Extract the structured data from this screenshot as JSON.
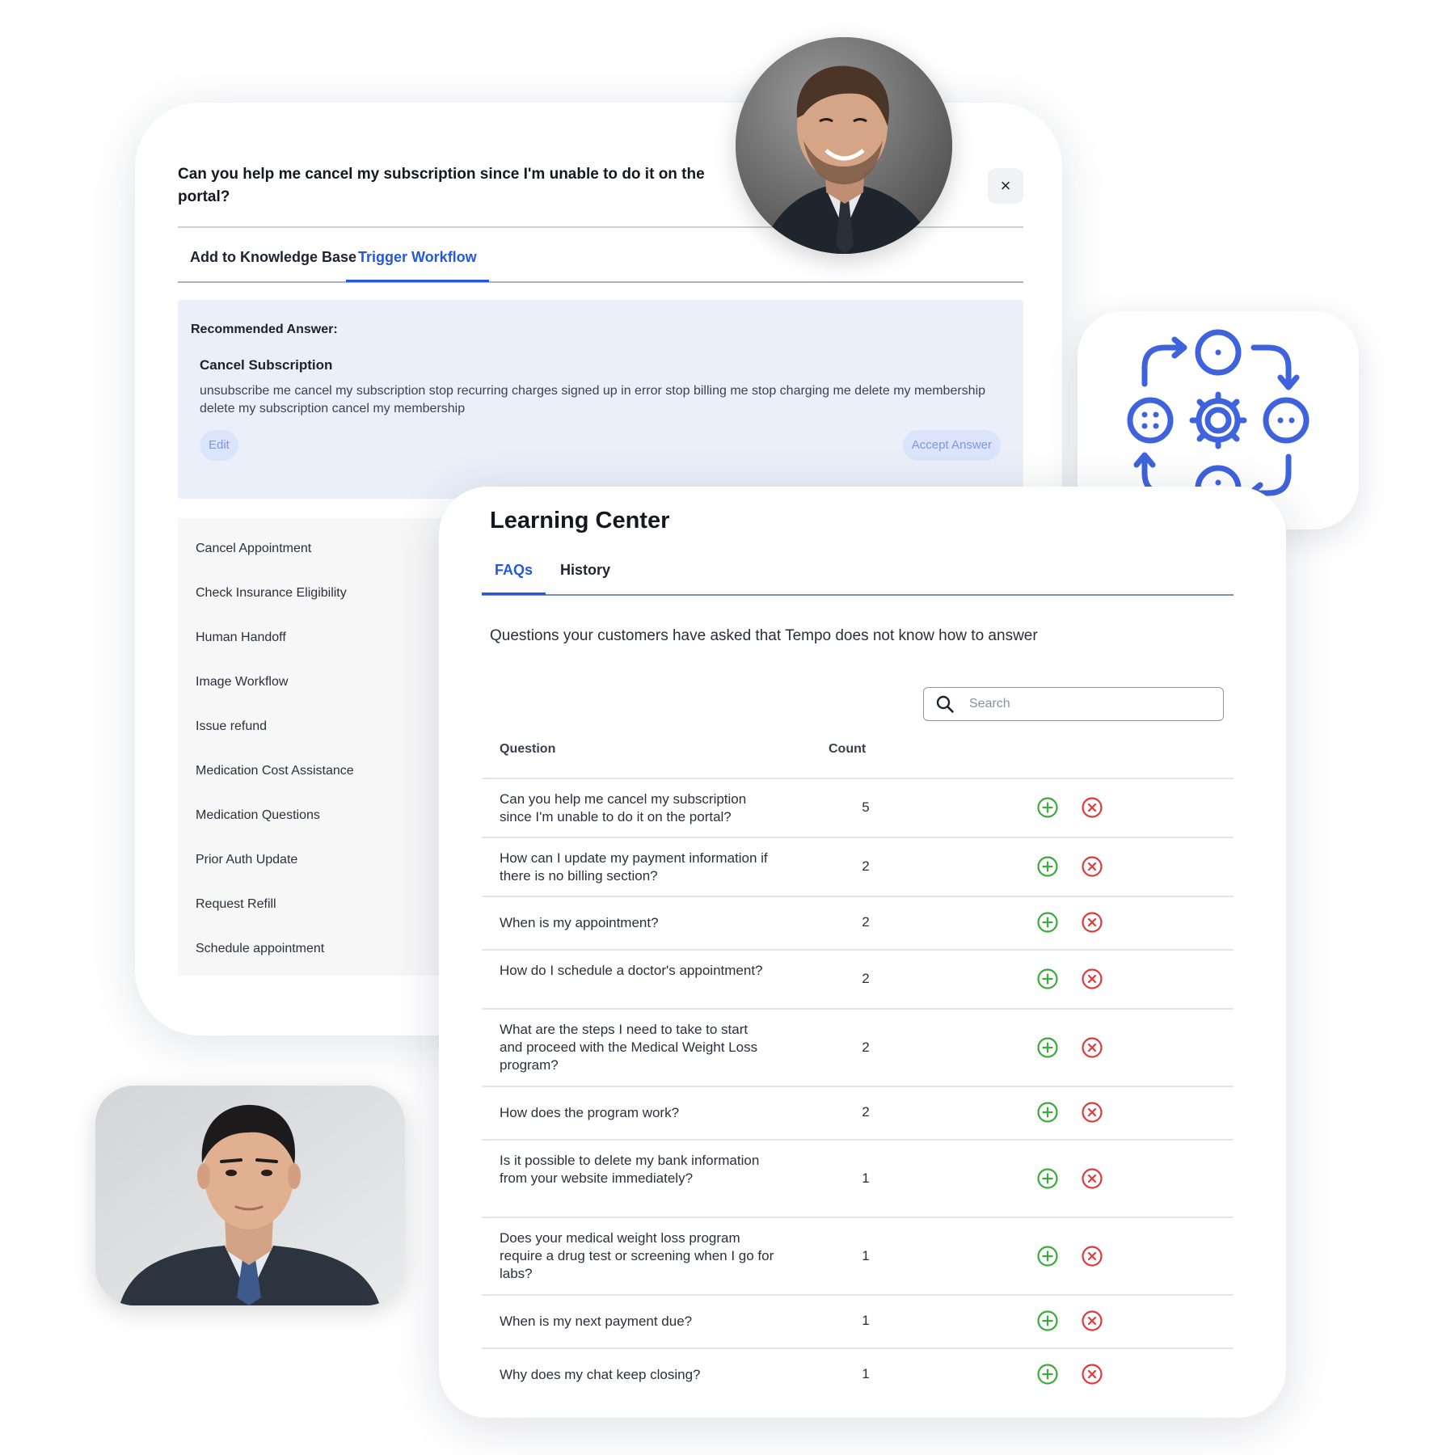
{
  "kb_dialog": {
    "question": "Can you help me cancel my subscription since I'm unable to do it on the portal?",
    "close_label": "×",
    "tabs": [
      {
        "label": "Add to Knowledge Base",
        "active": false
      },
      {
        "label": "Trigger Workflow",
        "active": true
      }
    ],
    "recommended": {
      "label": "Recommended Answer:",
      "title": "Cancel Subscription",
      "body": "unsubscribe me cancel my subscription stop recurring charges signed up in error stop billing me stop charging me delete my membership delete my subscription cancel my membership",
      "edit_label": "Edit",
      "accept_label": "Accept Answer"
    },
    "workflows": [
      "Cancel Appointment",
      "Check Insurance Eligibility",
      "Human Handoff",
      "Image Workflow",
      "Issue refund",
      "Medication Cost Assistance",
      "Medication Questions",
      "Prior Auth Update",
      "Request Refill",
      "Schedule appointment"
    ]
  },
  "learning_center": {
    "title": "Learning Center",
    "tabs": [
      {
        "label": "FAQs",
        "active": true
      },
      {
        "label": "History",
        "active": false
      }
    ],
    "subtitle": "Questions your customers have asked that Tempo does not know how to answer",
    "search": {
      "placeholder": "Search",
      "value": ""
    },
    "columns": {
      "question": "Question",
      "count": "Count"
    },
    "rows": [
      {
        "question": "Can you help me cancel my subscription since I'm unable to do it on the portal?",
        "count": "5"
      },
      {
        "question": "How can I update my payment information if there is no billing section?",
        "count": "2"
      },
      {
        "question": "When is my appointment?",
        "count": "2"
      },
      {
        "question": "How do I schedule a doctor's appointment?",
        "count": "2"
      },
      {
        "question": "What are the steps I need to take to start and proceed with the Medical Weight Loss program?",
        "count": "2"
      },
      {
        "question": "How does the program work?",
        "count": "2"
      },
      {
        "question": "Is it possible to delete my bank information from your website immediately?",
        "count": "1"
      },
      {
        "question": "Does your medical weight loss program require a drug test or screening when I go for labs?",
        "count": "1"
      },
      {
        "question": "When is my next payment due?",
        "count": "1"
      },
      {
        "question": "Why does my chat keep closing?",
        "count": "1"
      }
    ],
    "icons": {
      "add": "add-circle-icon",
      "remove": "remove-circle-icon"
    }
  },
  "colors": {
    "accent": "#2458e0",
    "workflow_icon": "#3e63dd",
    "add_green": "#3caa3c",
    "remove_red": "#e0393e",
    "recommended_bg": "#eaeffa"
  },
  "icons": {
    "workflow_card": "workflow-cycle-icon",
    "avatar_top": "avatar-man-smiling",
    "avatar_bottom": "avatar-man-suit"
  }
}
